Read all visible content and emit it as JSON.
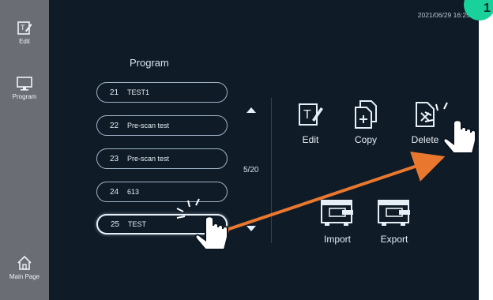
{
  "sidebar": {
    "items": [
      {
        "label": "Edit",
        "icon": "edit-icon"
      },
      {
        "label": "Program",
        "icon": "monitor-icon"
      },
      {
        "label": "Main Page",
        "icon": "home-icon"
      }
    ]
  },
  "header": {
    "timestamp": "2021/06/29 16:25:4"
  },
  "program_panel": {
    "title": "Program",
    "items": [
      {
        "number": "21",
        "name": "TEST1"
      },
      {
        "number": "22",
        "name": "Pre-scan test"
      },
      {
        "number": "23",
        "name": "Pre-scan test"
      },
      {
        "number": "24",
        "name": "613"
      },
      {
        "number": "25",
        "name": "TEST"
      }
    ],
    "selected_number": "25",
    "page_indicator": "5/20"
  },
  "actions": {
    "edit_label": "Edit",
    "copy_label": "Copy",
    "delete_label": "Delete",
    "import_label": "Import",
    "export_label": "Export"
  },
  "badge": {
    "text": "1",
    "color": "#19d19a"
  },
  "colors": {
    "background": "#0f1b27",
    "sidebar": "#6a6d74",
    "arrow": "#e9782e",
    "badge": "#19d19a"
  }
}
